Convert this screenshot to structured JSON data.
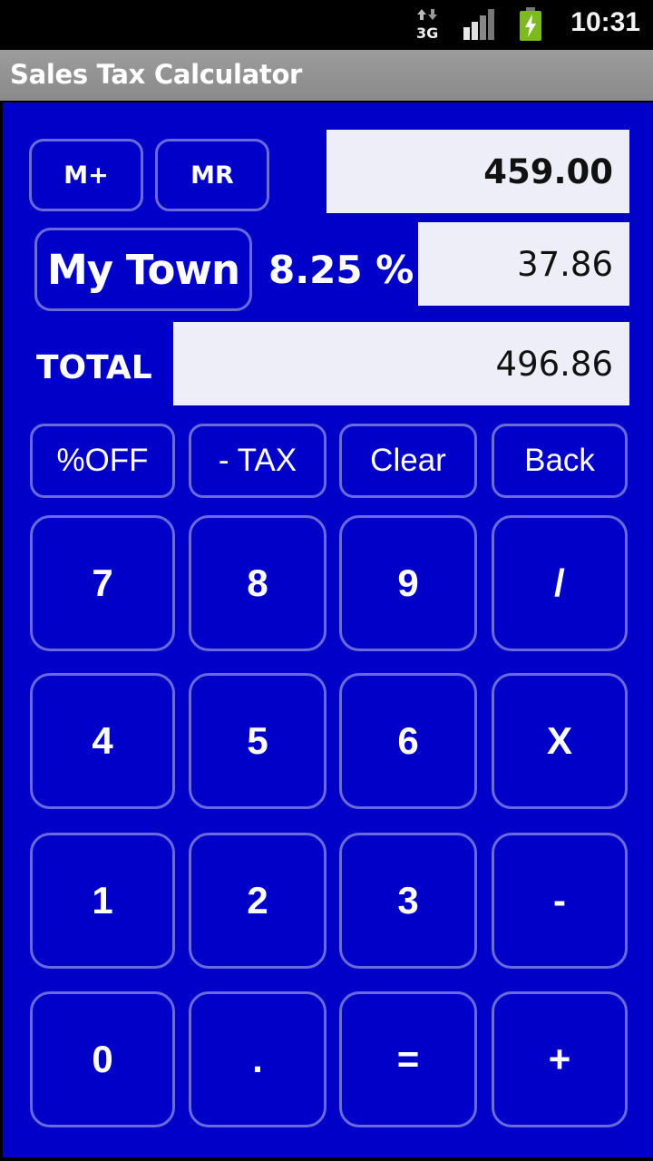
{
  "status_bar": {
    "network_type": "3G",
    "time": "10:31",
    "icons": [
      "data-3g-icon",
      "signal-strength-icon",
      "battery-charging-icon"
    ]
  },
  "app": {
    "title": "Sales Tax Calculator"
  },
  "memory": {
    "m_plus_label": "M+",
    "mr_label": "MR"
  },
  "displays": {
    "amount": "459.00",
    "tax": "37.86",
    "total": "496.86"
  },
  "location": {
    "town_label": "My Town",
    "tax_rate": "8.25 %"
  },
  "total_label": "TOTAL",
  "function_keys": [
    {
      "label": "%OFF"
    },
    {
      "label": "- TAX"
    },
    {
      "label": "Clear"
    },
    {
      "label": "Back"
    }
  ],
  "keypad": [
    {
      "label": "7"
    },
    {
      "label": "8"
    },
    {
      "label": "9"
    },
    {
      "label": "/"
    },
    {
      "label": "4"
    },
    {
      "label": "5"
    },
    {
      "label": "6"
    },
    {
      "label": "X"
    },
    {
      "label": "1"
    },
    {
      "label": "2"
    },
    {
      "label": "3"
    },
    {
      "label": "-"
    },
    {
      "label": "0"
    },
    {
      "label": "."
    },
    {
      "label": "="
    },
    {
      "label": "+"
    }
  ],
  "colors": {
    "background": "#0000c8",
    "button_border": "#6a6adc",
    "display_bg": "#eeeef8",
    "title_bar": "#9c9c9c"
  }
}
